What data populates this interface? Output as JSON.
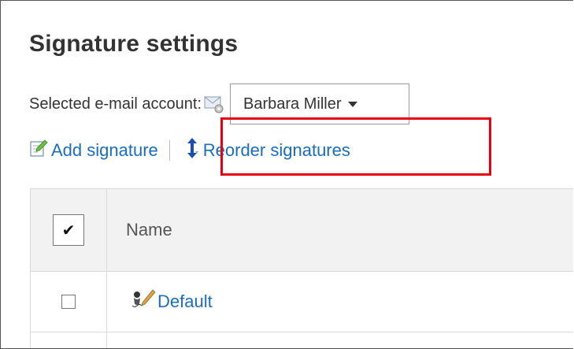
{
  "page": {
    "title": "Signature settings"
  },
  "account": {
    "label": "Selected e-mail account:",
    "selected": "Barbara Miller",
    "icon": "mail-settings-icon"
  },
  "actions": {
    "add_label": "Add signature",
    "add_icon": "edit-icon",
    "reorder_label": "Reorder signatures",
    "reorder_icon": "reorder-arrows-icon"
  },
  "highlight": {
    "color": "#e60012",
    "target": "Reorder signatures"
  },
  "table": {
    "select_all_mark": "✔",
    "name_header": "Name",
    "rows": [
      {
        "name": "Default",
        "icon": "signature-pen-icon",
        "checked": false
      }
    ]
  },
  "colors": {
    "link": "#1a6dbf",
    "header_bg": "#f2f2f2",
    "border": "#d9d9d9"
  }
}
